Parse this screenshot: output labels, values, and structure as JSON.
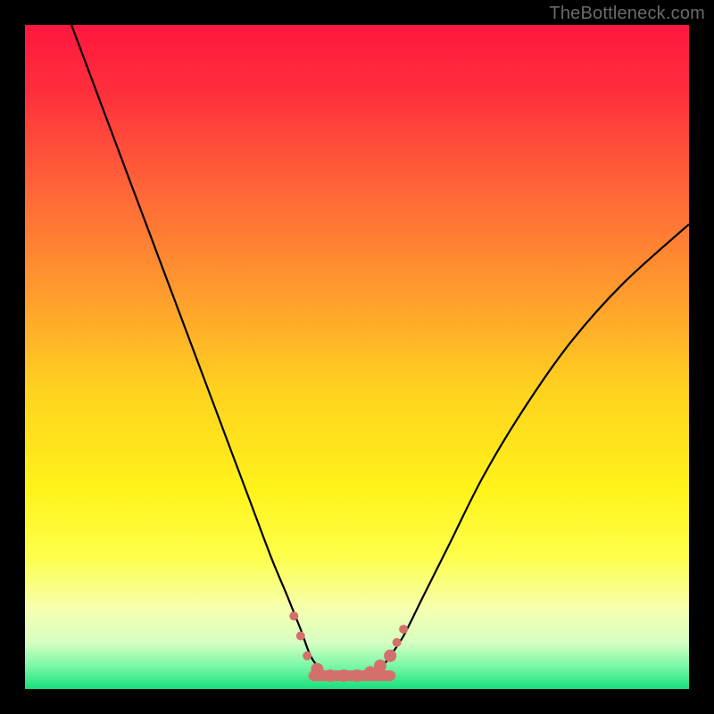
{
  "watermark": "TheBottleneck.com",
  "chart_data": {
    "type": "line",
    "title": "",
    "xlabel": "",
    "ylabel": "",
    "xlim": [
      0,
      100
    ],
    "ylim": [
      0,
      100
    ],
    "grid": false,
    "legend": false,
    "gradient_stops": [
      {
        "offset": 0.0,
        "color": "#ff173f"
      },
      {
        "offset": 0.1,
        "color": "#ff2f3c"
      },
      {
        "offset": 0.25,
        "color": "#ff6638"
      },
      {
        "offset": 0.4,
        "color": "#ff9a2e"
      },
      {
        "offset": 0.55,
        "color": "#ffd21f"
      },
      {
        "offset": 0.7,
        "color": "#fff31a"
      },
      {
        "offset": 0.8,
        "color": "#fdff4a"
      },
      {
        "offset": 0.88,
        "color": "#f6ffb0"
      },
      {
        "offset": 0.93,
        "color": "#d6ffc2"
      },
      {
        "offset": 0.965,
        "color": "#7bf7a8"
      },
      {
        "offset": 1.0,
        "color": "#19e07c"
      }
    ],
    "series": [
      {
        "name": "bottleneck-curve",
        "color": "#000000",
        "width": 2.2,
        "x": [
          7,
          10,
          13,
          16,
          19,
          22,
          25,
          28,
          31,
          34,
          37,
          39.5,
          41.5,
          43,
          44.5,
          46,
          48,
          50,
          52,
          53.5,
          55,
          57,
          60,
          64,
          69,
          75,
          82,
          90,
          100
        ],
        "y": [
          100,
          92,
          84,
          76,
          68,
          60,
          52,
          44,
          36,
          28,
          20,
          14,
          9,
          5,
          3,
          2,
          2,
          2,
          2,
          3,
          5,
          8,
          14,
          22,
          32,
          42,
          52,
          61,
          70
        ]
      }
    ],
    "markers": {
      "name": "valley-markers",
      "color": "#d4706b",
      "radius_small": 5,
      "radius_large": 7,
      "points": [
        {
          "x": 40.5,
          "y": 11,
          "r": "small"
        },
        {
          "x": 41.5,
          "y": 8,
          "r": "small"
        },
        {
          "x": 42.5,
          "y": 5,
          "r": "small"
        },
        {
          "x": 44.0,
          "y": 3,
          "r": "large"
        },
        {
          "x": 46.0,
          "y": 2,
          "r": "large"
        },
        {
          "x": 48.0,
          "y": 2,
          "r": "large"
        },
        {
          "x": 50.0,
          "y": 2,
          "r": "large"
        },
        {
          "x": 52.0,
          "y": 2.5,
          "r": "large"
        },
        {
          "x": 53.5,
          "y": 3.5,
          "r": "large"
        },
        {
          "x": 55.0,
          "y": 5,
          "r": "large"
        },
        {
          "x": 56.0,
          "y": 7,
          "r": "small"
        },
        {
          "x": 57.0,
          "y": 9,
          "r": "small"
        }
      ],
      "valley_bar": {
        "x0": 43.5,
        "x1": 55.0,
        "y": 2,
        "thickness": 12
      }
    }
  }
}
